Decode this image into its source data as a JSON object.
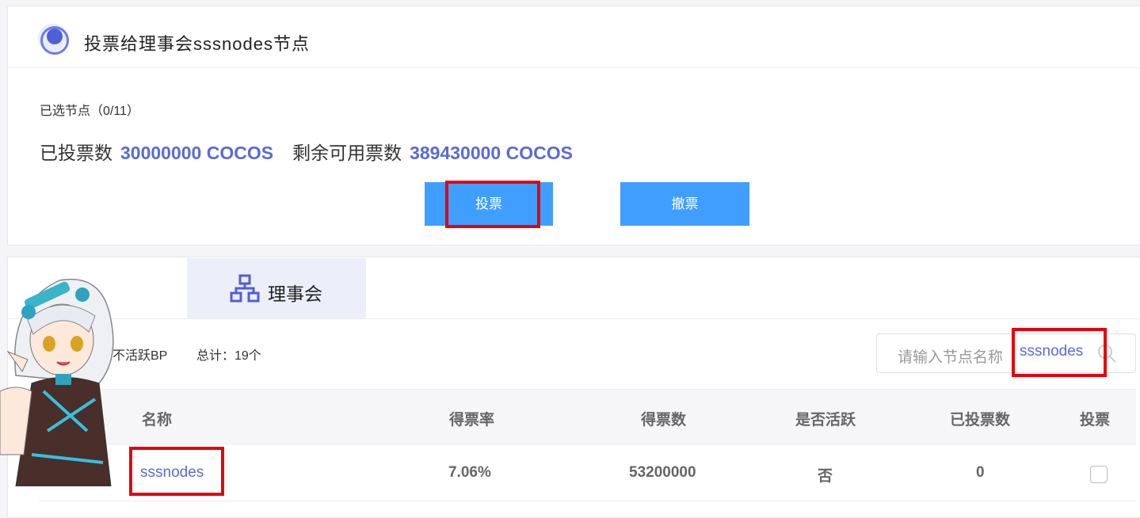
{
  "header": {
    "title": "投票给理事会sssnodes节点"
  },
  "summary": {
    "selected_label": "已选节点（0/11）",
    "voted_label": "已投票数",
    "voted_value": "30000000 COCOS",
    "remaining_label": "剩余可用票数",
    "remaining_value": "389430000 COCOS"
  },
  "actions": {
    "vote_label": "投票",
    "unvote_label": "撤票"
  },
  "tabs": [
    {
      "label": "理事会",
      "icon": "council-network-icon"
    }
  ],
  "filters": {
    "inactive_label": "不活跃BP",
    "total_label": "总计：19个"
  },
  "search": {
    "placeholder": "请输入节点名称",
    "value": "sssnodes"
  },
  "table": {
    "columns": [
      "名称",
      "得票率",
      "得票数",
      "是否活跃",
      "已投票数",
      "投票"
    ],
    "rows": [
      {
        "name": "sssnodes",
        "rate": "7.06%",
        "votes": "53200000",
        "active": "否",
        "my_votes": "0",
        "checked": false
      }
    ]
  },
  "colors": {
    "accent": "#409eff",
    "link": "#5a6bd2",
    "highlight": "#e8000b"
  }
}
